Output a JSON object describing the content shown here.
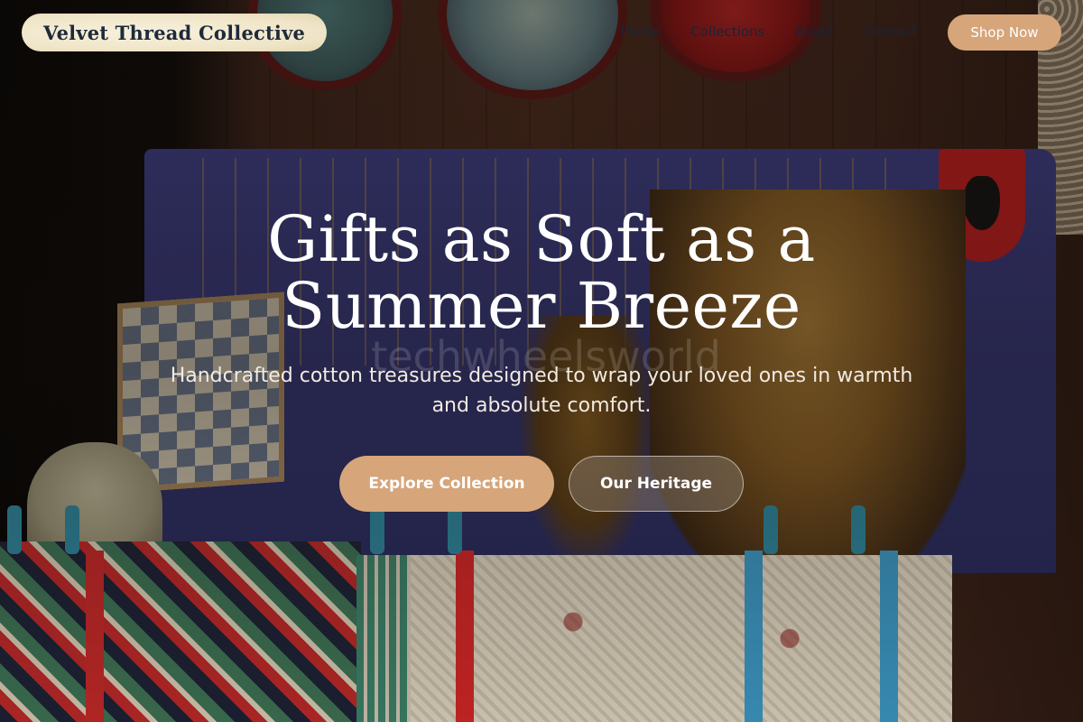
{
  "brand": {
    "name": "Velvet Thread Collective"
  },
  "nav": {
    "items": [
      {
        "label": "Home"
      },
      {
        "label": "Collections"
      },
      {
        "label": "About"
      },
      {
        "label": "Contact"
      }
    ],
    "cta_label": "Shop Now"
  },
  "hero": {
    "title": "Gifts as Soft as a Summer Breeze",
    "subtitle": "Handcrafted cotton treasures designed to wrap your loved ones in warmth and absolute comfort.",
    "watermark": "techwheelsworld",
    "primary_button": "Explore Collection",
    "secondary_button": "Our Heritage"
  },
  "colors": {
    "accent": "#d6a57a",
    "brand_pill": "#efe4c6",
    "brand_text": "#1e2a3a",
    "nav_text": "#1a2438"
  }
}
